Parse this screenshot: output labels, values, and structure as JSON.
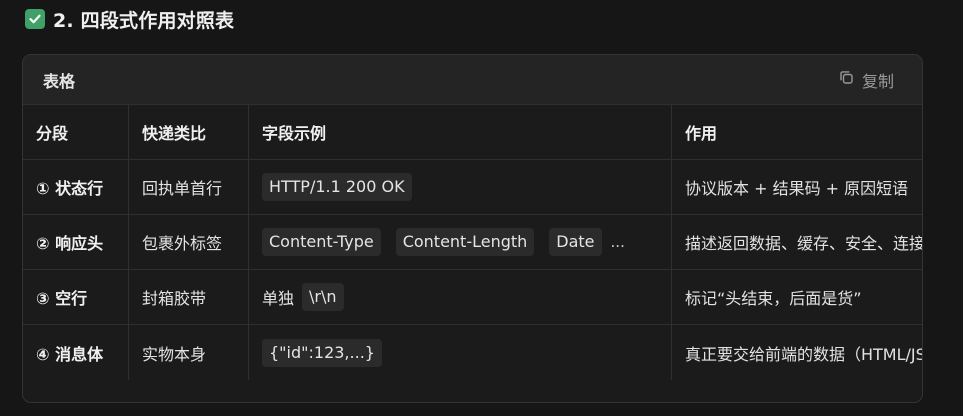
{
  "section_title": "2. 四段式作用对照表",
  "card": {
    "title": "表格",
    "copy_label": "复制"
  },
  "table": {
    "headers": [
      "分段",
      "快递类比",
      "字段示例",
      "作用"
    ],
    "rows": [
      {
        "segment": "① 状态行",
        "analogy": "回执单首行",
        "example_prefix": "",
        "example_codes": [
          "HTTP/1.1 200 OK"
        ],
        "example_more": "",
        "purpose": "协议版本 + 结果码 + 原因短语"
      },
      {
        "segment": "② 响应头",
        "analogy": "包裹外标签",
        "example_prefix": "",
        "example_codes": [
          "Content-Type",
          "Content-Length",
          "Date"
        ],
        "example_more": "...",
        "purpose": "描述返回数据、缓存、安全、连接等"
      },
      {
        "segment": "③ 空行",
        "analogy": "封箱胶带",
        "example_prefix": "单独",
        "example_codes": [
          "\\r\\n"
        ],
        "example_more": "",
        "purpose": "标记“头结束，后面是货”"
      },
      {
        "segment": "④ 消息体",
        "analogy": "实物本身",
        "example_prefix": "",
        "example_codes": [
          "{\"id\":123,...}"
        ],
        "example_more": "",
        "purpose": "真正要交给前端的数据（HTML/JSON）"
      }
    ]
  },
  "colors": {
    "background": "#161616",
    "card": "#1b1b1b",
    "header": "#242424",
    "check": "#3fa068"
  },
  "icons": [
    "check-box-icon",
    "copy-icon"
  ]
}
